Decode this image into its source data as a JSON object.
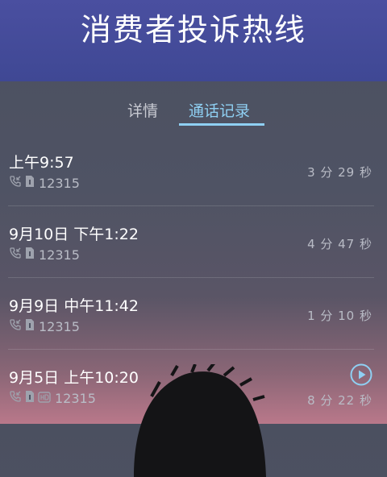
{
  "header": {
    "title": "消费者投诉热线"
  },
  "tabs": [
    {
      "label": "详情",
      "active": false
    },
    {
      "label": "通话记录",
      "active": true
    }
  ],
  "calls": [
    {
      "time": "上午9:57",
      "number": "12315",
      "duration": "3 分 29 秒",
      "recorded": false
    },
    {
      "time": "9月10日 下午1:22",
      "number": "12315",
      "duration": "4 分 47 秒",
      "recorded": false
    },
    {
      "time": "9月9日 中午11:42",
      "number": "12315",
      "duration": "1 分 10 秒",
      "recorded": false
    },
    {
      "time": "9月5日 上午10:20",
      "number": "12315",
      "duration": "8 分 22 秒",
      "recorded": true
    }
  ],
  "icons": {
    "call_type": "incoming-call-icon",
    "sim": "sim-card-icon",
    "hd": "hd-voice-icon",
    "play": "play-icon"
  },
  "colors": {
    "header_bg": "#4048a0",
    "accent": "#8fd0f3",
    "secondary_text": "#b9bcc6"
  }
}
